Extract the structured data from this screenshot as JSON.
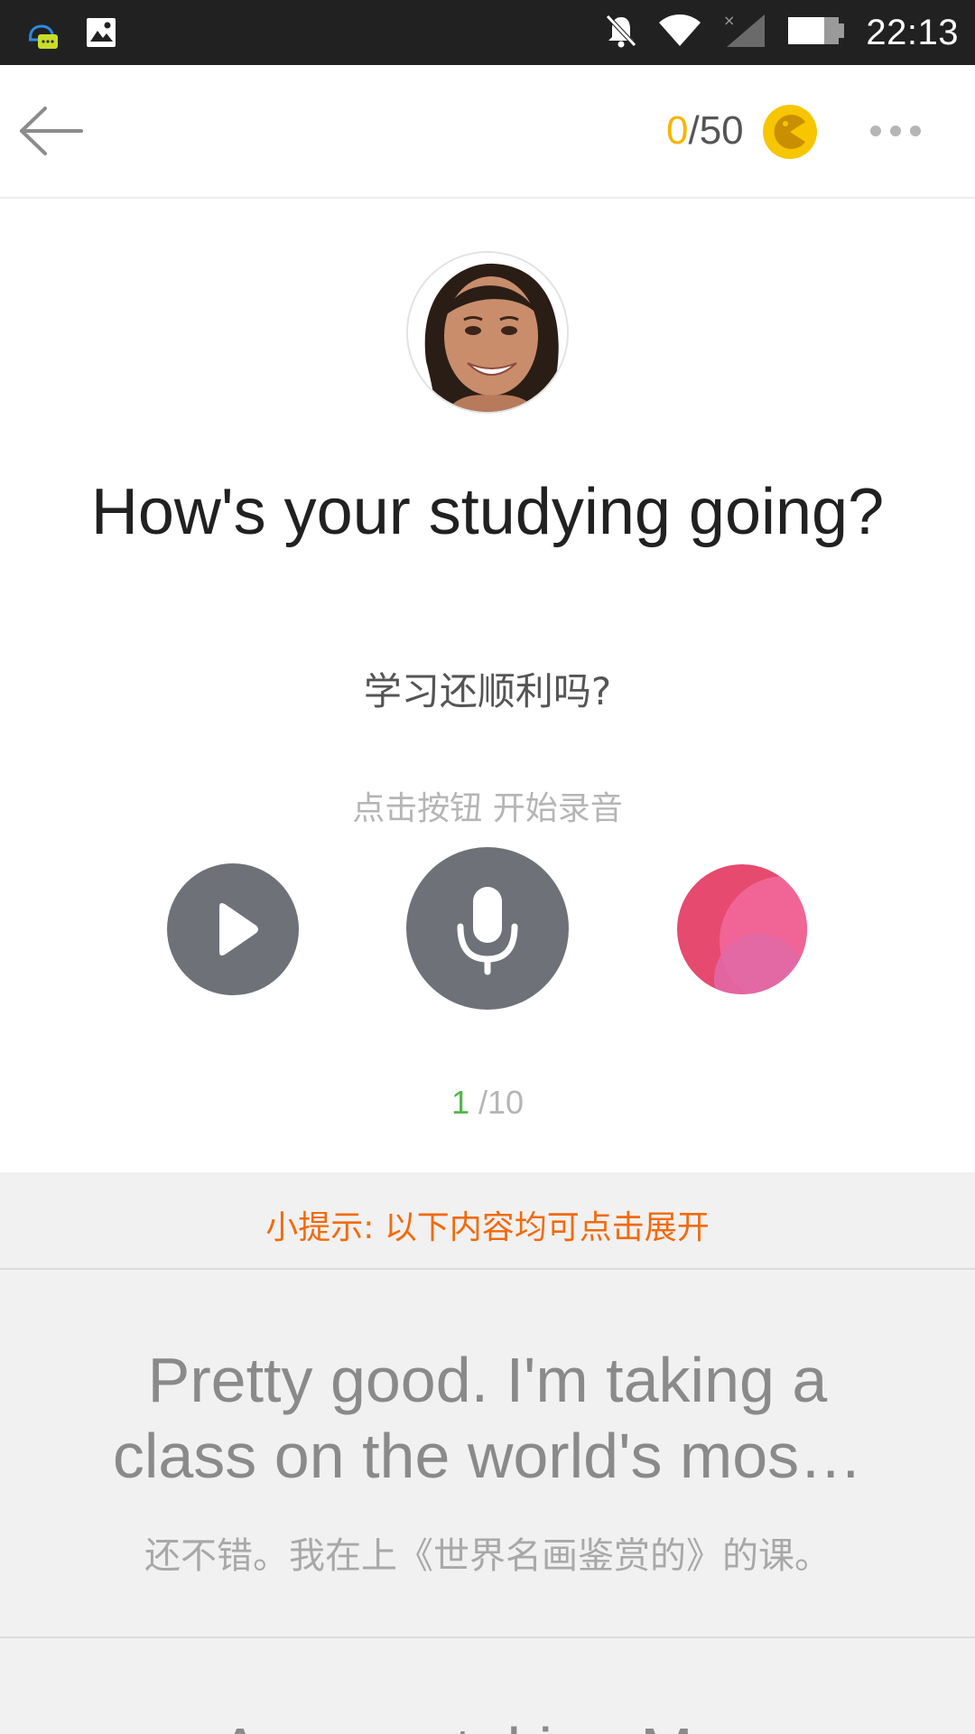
{
  "status_bar": {
    "time": "22:13",
    "icons": [
      "qq-notification-icon",
      "gallery-notification-icon",
      "mute-bell-icon",
      "wifi-icon",
      "signal-icon",
      "battery-icon"
    ]
  },
  "header": {
    "back_icon": "arrow-left-icon",
    "score_current": "0",
    "score_total": "/50",
    "coin_icon": "coin-icon",
    "more_icon": "more-dots-icon"
  },
  "lesson": {
    "avatar_icon": "speaker-avatar",
    "question_en": "How's your studying going?",
    "question_zh": "学习还顺利吗?",
    "record_hint": "点击按钮 开始录音",
    "controls": {
      "play_icon": "play-icon",
      "mic_icon": "microphone-icon",
      "score_icon": "score-bubble-icon"
    },
    "progress_current": "1",
    "progress_total": "/10"
  },
  "tip": {
    "text": "小提示: 以下内容均可点击展开"
  },
  "answer": {
    "en": "Pretty good. I'm taking a class on the world's mos…",
    "zh": "还不错。我在上《世界名画鉴赏的》的课。"
  },
  "next_answer": {
    "en": "Are you taking M…"
  },
  "colors": {
    "accent_orange": "#f26a0c",
    "score_yellow": "#F7B500",
    "progress_green": "#52b64a",
    "control_gray": "#6e7278",
    "score_pink": "#ec4a72"
  }
}
